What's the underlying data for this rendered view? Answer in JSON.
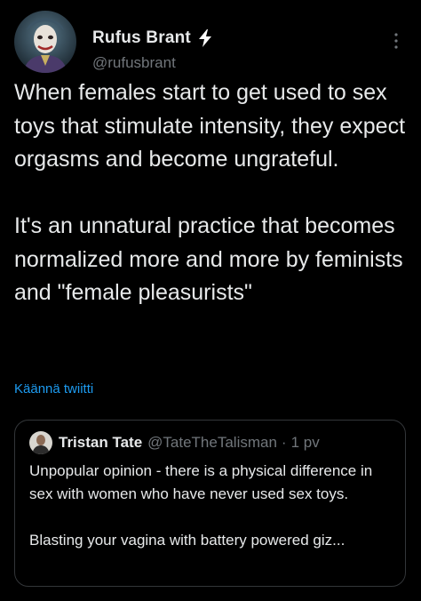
{
  "author": {
    "display_name": "Rufus Brant",
    "handle": "@rufusbrant",
    "avatar_icon": "avatar-image",
    "badge_icon": "lightning-bolt-icon",
    "menu_icon": "more-vertical-icon"
  },
  "tweet": {
    "text": "When females start to get used to sex toys that stimulate intensity, they expect orgasms and become ungrateful.\n\nIt's an unnatural practice that becomes normalized more and more by feminists and \"female pleasurists\"",
    "translate_label": "Käännä twiitti"
  },
  "quoted_tweet": {
    "display_name": "Tristan Tate",
    "handle": "@TateTheTalisman",
    "separator": "·",
    "time": "1 pv",
    "text": "Unpopular opinion - there is a physical difference in sex with women who have never used sex toys.\n\nBlasting your vagina with battery powered giz..."
  },
  "colors": {
    "background": "#000000",
    "text_primary": "#e7e9ea",
    "text_secondary": "#71767b",
    "link": "#1d9bf0",
    "border": "#333639",
    "bolt": "#ffffff"
  }
}
